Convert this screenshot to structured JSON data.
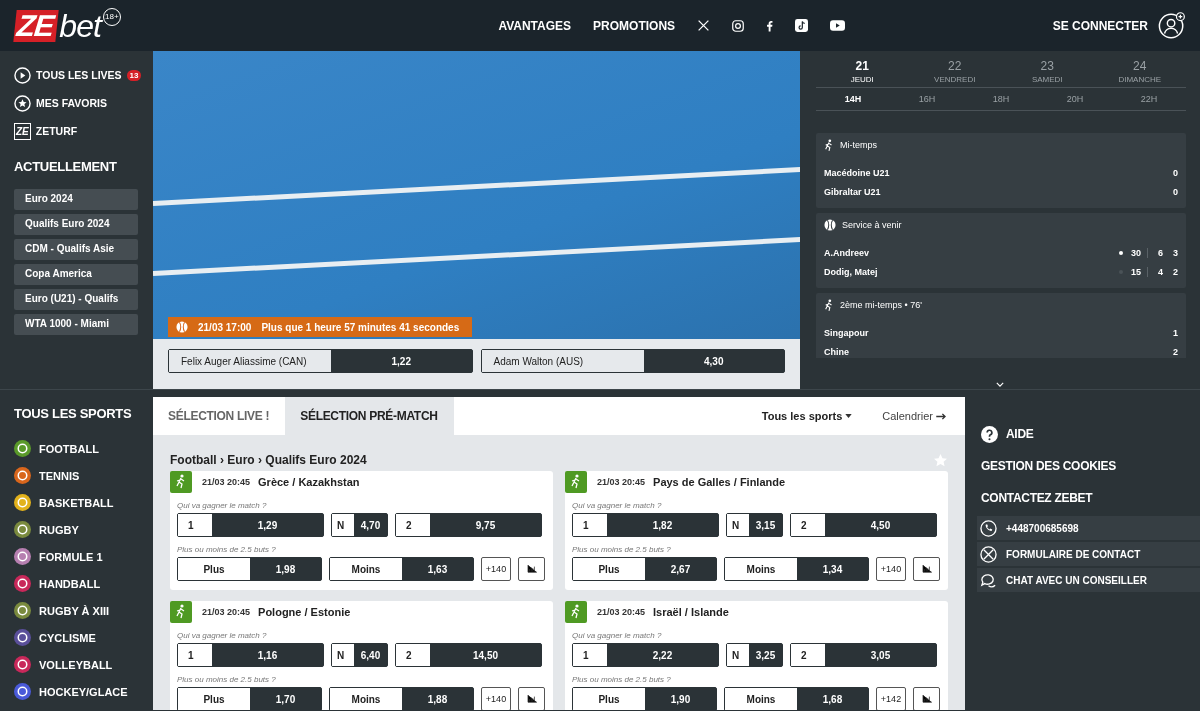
{
  "header": {
    "logo": {
      "mark": "ZE",
      "word": "bet",
      "age": "18+"
    },
    "nav": [
      "AVANTAGES",
      "PROMOTIONS"
    ],
    "login": "SE CONNECTER"
  },
  "sidebar": {
    "links": [
      {
        "kind": "lives",
        "label": "TOUS LES LIVES",
        "badge": "13"
      },
      {
        "kind": "favorites",
        "label": "MES FAVORIS"
      },
      {
        "kind": "zeturf",
        "label": "ZETURF",
        "icon_text": "ZE"
      }
    ],
    "current_title": "ACTUELLEMENT",
    "current": [
      "Euro 2024",
      "Qualifs Euro 2024",
      "CDM - Qualifs Asie",
      "Copa America",
      "Euro (U21) - Qualifs",
      "WTA 1000 - Miami"
    ]
  },
  "hero": {
    "datetime": "21/03 17:00",
    "countdown": "Plus que 1 heure 57 minutes 41 secondes",
    "odds": [
      {
        "name": "Felix Auger Aliassime (CAN)",
        "odd": "1,22"
      },
      {
        "name": "Adam Walton (AUS)",
        "odd": "4,30"
      }
    ]
  },
  "schedule": {
    "days": [
      {
        "num": "21",
        "name": "JEUDI",
        "selected": true
      },
      {
        "num": "22",
        "name": "VENDREDI",
        "selected": false
      },
      {
        "num": "23",
        "name": "SAMEDI",
        "selected": false
      },
      {
        "num": "24",
        "name": "DIMANCHE",
        "selected": false
      }
    ],
    "hours": [
      {
        "label": "14H",
        "selected": true
      },
      {
        "label": "16H",
        "selected": false
      },
      {
        "label": "18H",
        "selected": false
      },
      {
        "label": "20H",
        "selected": false
      },
      {
        "label": "22H",
        "selected": false
      }
    ]
  },
  "live": [
    {
      "kind": "football",
      "status": "Mi-temps",
      "teams": [
        {
          "name": "Macédoine U21",
          "score": "0"
        },
        {
          "name": "Gibraltar U21",
          "score": "0"
        }
      ]
    },
    {
      "kind": "tennis",
      "status": "Service à venir",
      "teams": [
        {
          "name": "A.Andreev",
          "serving": true,
          "points": "30",
          "sets": [
            "6",
            "3"
          ]
        },
        {
          "name": "Dodig, Matej",
          "serving": false,
          "points": "15",
          "sets": [
            "4",
            "2"
          ]
        }
      ]
    },
    {
      "kind": "football",
      "status": "2ème mi-temps • 76'",
      "teams": [
        {
          "name": "Singapour",
          "score": "1"
        },
        {
          "name": "Chine",
          "score": "2"
        }
      ]
    }
  ],
  "sports": {
    "title": "TOUS LES SPORTS",
    "items": [
      {
        "name": "FOOTBALL",
        "color": "#5a9a2a"
      },
      {
        "name": "TENNIS",
        "color": "#d9661c"
      },
      {
        "name": "BASKETBALL",
        "color": "#e2b21c"
      },
      {
        "name": "RUGBY",
        "color": "#7a8a3e"
      },
      {
        "name": "FORMULE 1",
        "color": "#b67fb0"
      },
      {
        "name": "HANDBALL",
        "color": "#c8285a"
      },
      {
        "name": "RUGBY À XIII",
        "color": "#7a8a3e"
      },
      {
        "name": "CYCLISME",
        "color": "#5a4f9a"
      },
      {
        "name": "VOLLEYBALL",
        "color": "#c8285a"
      },
      {
        "name": "HOCKEY/GLACE",
        "color": "#4a5ad8"
      }
    ]
  },
  "selection": {
    "tabs": [
      {
        "label": "SÉLECTION LIVE !",
        "selected": false
      },
      {
        "label": "SÉLECTION PRÉ-MATCH",
        "selected": true
      }
    ],
    "filter": "Tous les sports",
    "calendar": "Calendrier",
    "breadcrumb": "Football › Euro › Qualifs Euro 2024",
    "matches": [
      {
        "time": "21/03 20:45",
        "teams": "Grèce / Kazakhstan",
        "q1": "Qui va gagner le match ?",
        "outcomes": [
          {
            "label": "1",
            "odd": "1,29"
          },
          {
            "label": "N",
            "odd": "4,70"
          },
          {
            "label": "2",
            "odd": "9,75"
          }
        ],
        "q2": "Plus ou moins de 2.5 buts ?",
        "totals": [
          {
            "label": "Plus",
            "odd": "1,98"
          },
          {
            "label": "Moins",
            "odd": "1,63"
          }
        ],
        "more": "+140"
      },
      {
        "time": "21/03 20:45",
        "teams": "Pays de Galles / Finlande",
        "q1": "Qui va gagner le match ?",
        "outcomes": [
          {
            "label": "1",
            "odd": "1,82"
          },
          {
            "label": "N",
            "odd": "3,15"
          },
          {
            "label": "2",
            "odd": "4,50"
          }
        ],
        "q2": "Plus ou moins de 2.5 buts ?",
        "totals": [
          {
            "label": "Plus",
            "odd": "2,67"
          },
          {
            "label": "Moins",
            "odd": "1,34"
          }
        ],
        "more": "+140"
      },
      {
        "time": "21/03 20:45",
        "teams": "Pologne / Estonie",
        "q1": "Qui va gagner le match ?",
        "outcomes": [
          {
            "label": "1",
            "odd": "1,16"
          },
          {
            "label": "N",
            "odd": "6,40"
          },
          {
            "label": "2",
            "odd": "14,50"
          }
        ],
        "q2": "Plus ou moins de 2.5 buts ?",
        "totals": [
          {
            "label": "Plus",
            "odd": "1,70"
          },
          {
            "label": "Moins",
            "odd": "1,88"
          }
        ],
        "more": "+140"
      },
      {
        "time": "21/03 20:45",
        "teams": "Israël / Islande",
        "q1": "Qui va gagner le match ?",
        "outcomes": [
          {
            "label": "1",
            "odd": "2,22"
          },
          {
            "label": "N",
            "odd": "3,25"
          },
          {
            "label": "2",
            "odd": "3,05"
          }
        ],
        "q2": "Plus ou moins de 2.5 buts ?",
        "totals": [
          {
            "label": "Plus",
            "odd": "1,90"
          },
          {
            "label": "Moins",
            "odd": "1,68"
          }
        ],
        "more": "+142"
      }
    ]
  },
  "help": {
    "aide": "AIDE",
    "cookies": "GESTION DES COOKIES",
    "contact_title": "CONTACTEZ ZEBET",
    "contacts": [
      {
        "kind": "phone",
        "label": "+448700685698"
      },
      {
        "kind": "form",
        "label": "FORMULAIRE DE CONTACT"
      },
      {
        "kind": "chat",
        "label": "CHAT AVEC UN CONSEILLER"
      }
    ]
  }
}
